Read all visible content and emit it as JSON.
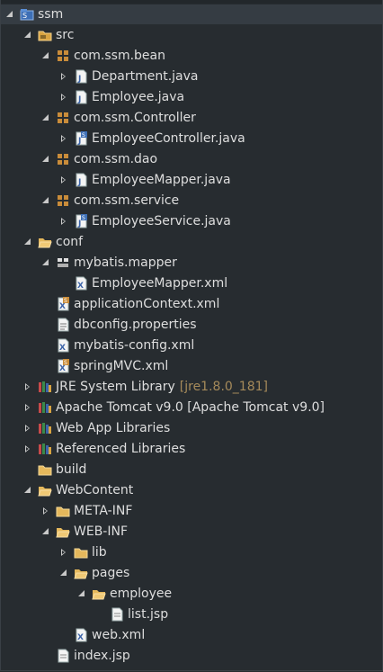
{
  "tree": {
    "project": {
      "label": "ssm"
    },
    "src": {
      "label": "src",
      "packages": [
        {
          "label": "com.ssm.bean",
          "files": [
            "Department.java",
            "Employee.java"
          ]
        },
        {
          "label": "com.ssm.Controller",
          "files": [
            "EmployeeController.java"
          ]
        },
        {
          "label": "com.ssm.dao",
          "files": [
            "EmployeeMapper.java"
          ]
        },
        {
          "label": "com.ssm.service",
          "files": [
            "EmployeeService.java"
          ]
        }
      ]
    },
    "conf": {
      "label": "conf",
      "mapper_package": "mybatis.mapper",
      "mapper_file": "EmployeeMapper.xml",
      "files": [
        "applicationContext.xml",
        "dbconfig.properties",
        "mybatis-config.xml",
        "springMVC.xml"
      ]
    },
    "libraries": [
      {
        "label": "JRE System Library",
        "decoration": "[jre1.8.0_181]"
      },
      {
        "label": "Apache Tomcat v9.0 [Apache Tomcat v9.0]",
        "decoration": ""
      },
      {
        "label": "Web App Libraries",
        "decoration": ""
      },
      {
        "label": "Referenced Libraries",
        "decoration": ""
      }
    ],
    "build": {
      "label": "build"
    },
    "webcontent": {
      "label": "WebContent",
      "meta_inf": "META-INF",
      "web_inf": "WEB-INF",
      "lib": "lib",
      "pages": "pages",
      "employee": "employee",
      "list_jsp": "list.jsp",
      "web_xml": "web.xml",
      "index_jsp": "index.jsp"
    }
  },
  "colors": {
    "background": "#272c30",
    "text": "#dedede",
    "decoration": "#a58a5a",
    "folder": "#e5b85c",
    "package": "#c98c3a",
    "java": "#4a78c4",
    "xml": "#6a8fd0"
  }
}
